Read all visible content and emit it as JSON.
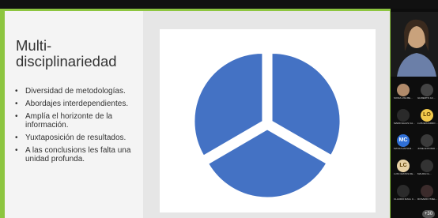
{
  "slide": {
    "title": "Multi-disciplinariedad",
    "bullets": [
      "Diversidad de metodologías.",
      "Abordajes interdependientes.",
      "Amplía el horizonte de la información.",
      "Yuxtaposición de resultados.",
      "A las conclusions les falta una unidad profunda."
    ]
  },
  "chart_data": {
    "type": "pie",
    "values": [
      33.3,
      33.3,
      33.4
    ],
    "exploded": true,
    "colors": [
      "#4472c4",
      "#4472c4",
      "#4472c4"
    ]
  },
  "participants": [
    {
      "name": "SONIA LISA BE...",
      "initials": "",
      "color": "#b08a6a"
    },
    {
      "name": "GILBERTO AC...",
      "initials": "",
      "color": "#444"
    },
    {
      "name": "MARIO ELIAS CA...",
      "initials": "",
      "color": "#2a2a2a"
    },
    {
      "name": "LUIS EDUARDO ...",
      "initials": "LO",
      "color": "#f2c94c"
    },
    {
      "name": "MAYRA ANTONI...",
      "initials": "MC",
      "color": "#2f6fd6"
    },
    {
      "name": "JOSE ANTONIO ...",
      "initials": "",
      "color": "#3a3a3a"
    },
    {
      "name": "LUIS CESTAS DE...",
      "initials": "LC",
      "color": "#e8d2a6"
    },
    {
      "name": "MAURA CL...",
      "initials": "",
      "color": "#333"
    },
    {
      "name": "CLAUDIO RAUL C...",
      "initials": "",
      "color": "#2b2b2b"
    },
    {
      "name": "ROSARIO ITZEL...",
      "initials": "",
      "color": "#3b2b2b"
    }
  ],
  "more_count": "+30"
}
